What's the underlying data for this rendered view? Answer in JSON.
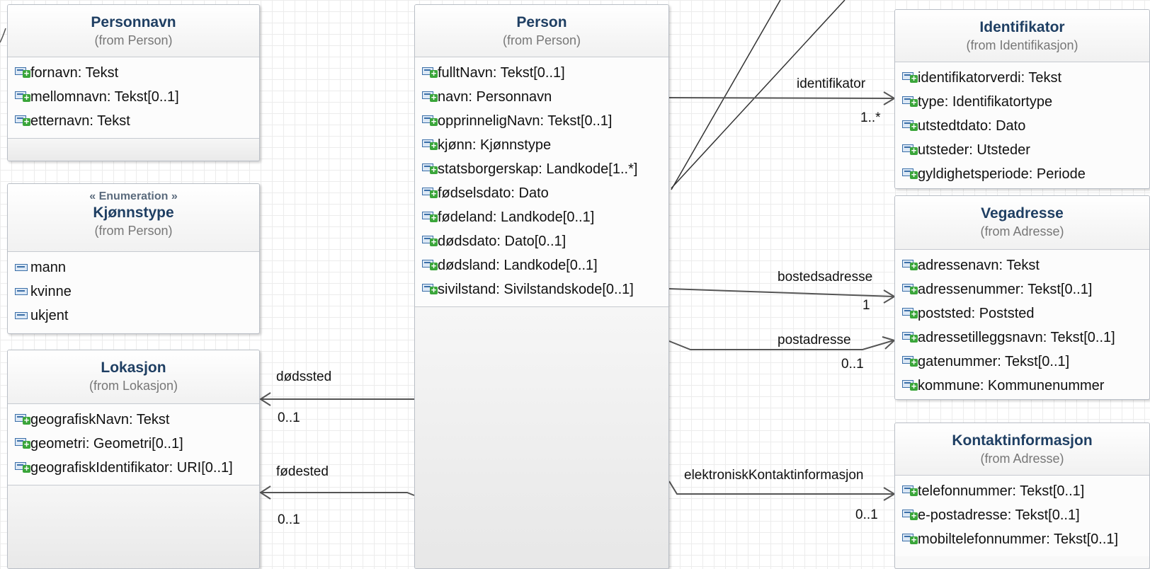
{
  "classes": {
    "personnavn": {
      "name": "Personnavn",
      "from": "(from Person)",
      "attributes": [
        "fornavn: Tekst",
        "mellomnavn: Tekst[0..1]",
        "etternavn: Tekst"
      ]
    },
    "kjonnstype": {
      "stereotype": "« Enumeration »",
      "name": "Kjønnstype",
      "from": "(from Person)",
      "literals": [
        "mann",
        "kvinne",
        "ukjent"
      ]
    },
    "lokasjon": {
      "name": "Lokasjon",
      "from": "(from Lokasjon)",
      "attributes": [
        "geografiskNavn: Tekst",
        "geometri: Geometri[0..1]",
        "geografiskIdentifikator: URI[0..1]"
      ]
    },
    "person": {
      "name": "Person",
      "from": "(from Person)",
      "attributes": [
        "fulltNavn: Tekst[0..1]",
        "navn: Personnavn",
        "opprinneligNavn: Tekst[0..1]",
        "kjønn: Kjønnstype",
        "statsborgerskap: Landkode[1..*]",
        "fødselsdato: Dato",
        "fødeland: Landkode[0..1]",
        "dødsdato: Dato[0..1]",
        "dødsland: Landkode[0..1]",
        "sivilstand: Sivilstandskode[0..1]"
      ]
    },
    "identifikator": {
      "name": "Identifikator",
      "from": "(from Identifikasjon)",
      "attributes": [
        "identifikatorverdi: Tekst",
        "type: Identifikatortype",
        "utstedtdato: Dato",
        "utsteder: Utsteder",
        "gyldighetsperiode: Periode"
      ]
    },
    "vegadresse": {
      "name": "Vegadresse",
      "from": "(from Adresse)",
      "attributes": [
        "adressenavn: Tekst",
        "adressenummer: Tekst[0..1]",
        "poststed: Poststed",
        "adressetilleggsnavn: Tekst[0..1]",
        "gatenummer: Tekst[0..1]",
        "kommune: Kommunenummer"
      ]
    },
    "kontaktinformasjon": {
      "name": "Kontaktinformasjon",
      "from": "(from Adresse)",
      "attributes": [
        "telefonnummer: Tekst[0..1]",
        "e-postadresse: Tekst[0..1]",
        "mobiltelefonnummer: Tekst[0..1]"
      ]
    }
  },
  "associations": {
    "identifikator": {
      "role": "identifikator",
      "multiplicity": "1..*"
    },
    "bostedsadresse": {
      "role": "bostedsadresse",
      "multiplicity": "1"
    },
    "postadresse": {
      "role": "postadresse",
      "multiplicity": "0..1"
    },
    "elektronisk": {
      "role": "elektroniskKontaktinformasjon",
      "multiplicity": "0..1"
    },
    "dodssted": {
      "role": "dødssted",
      "multiplicity": "0..1"
    },
    "fodested": {
      "role": "fødested",
      "multiplicity": "0..1"
    }
  },
  "icons": {
    "attribute": "attribute-icon",
    "literal": "enum-literal-icon"
  },
  "colors": {
    "class_title": "#1f3f63",
    "edge": "#555555",
    "icon": "#3b6fa8",
    "icon_plus": "#3aa53a"
  }
}
